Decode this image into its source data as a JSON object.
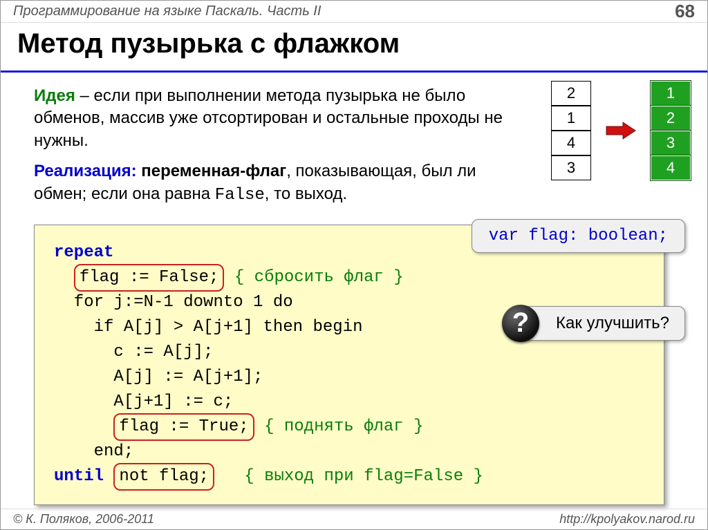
{
  "header": {
    "left": "Программирование на языке Паскаль. Часть II",
    "page": "68"
  },
  "title": "Метод пузырька с флажком",
  "idea": {
    "kw_idea": "Идея",
    "text_idea": " – если при выполнении метода пузырька не было обменов, массив уже отсортирован и остальные проходы не нужны.",
    "kw_real": "Реализация:",
    "bold_real": " переменная-флаг",
    "text_real1": ", показывающая, был ли обмен; если она равна ",
    "false_code": "False",
    "text_real2": ", то выход."
  },
  "arrays": {
    "before": [
      "2",
      "1",
      "4",
      "3"
    ],
    "after": [
      "1",
      "2",
      "3",
      "4"
    ]
  },
  "callouts": {
    "var_decl": "var flag: boolean;",
    "question": "Как улучшить?",
    "q_mark": "?"
  },
  "code": {
    "l1_repeat": "repeat",
    "l2_flag_false": "flag := False;",
    "l2_cm": "{ cбросить флаг }",
    "l3": "  for j:=N-1 downto 1 do",
    "l4": "    if A[j] > A[j+1] then begin",
    "l5": "      c := A[j];",
    "l6": "      A[j] := A[j+1];",
    "l7": "      A[j+1] := c;",
    "l8_flag_true": "flag := True;",
    "l8_cm": "{ поднять флаг }",
    "l9": "    end;",
    "l10_until": "until",
    "l10_not_flag": "not flag;",
    "l10_cm": "{ выход при flag=False }"
  },
  "footer": {
    "left": "© К. Поляков, 2006-2011",
    "right": "http://kpolyakov.narod.ru"
  }
}
